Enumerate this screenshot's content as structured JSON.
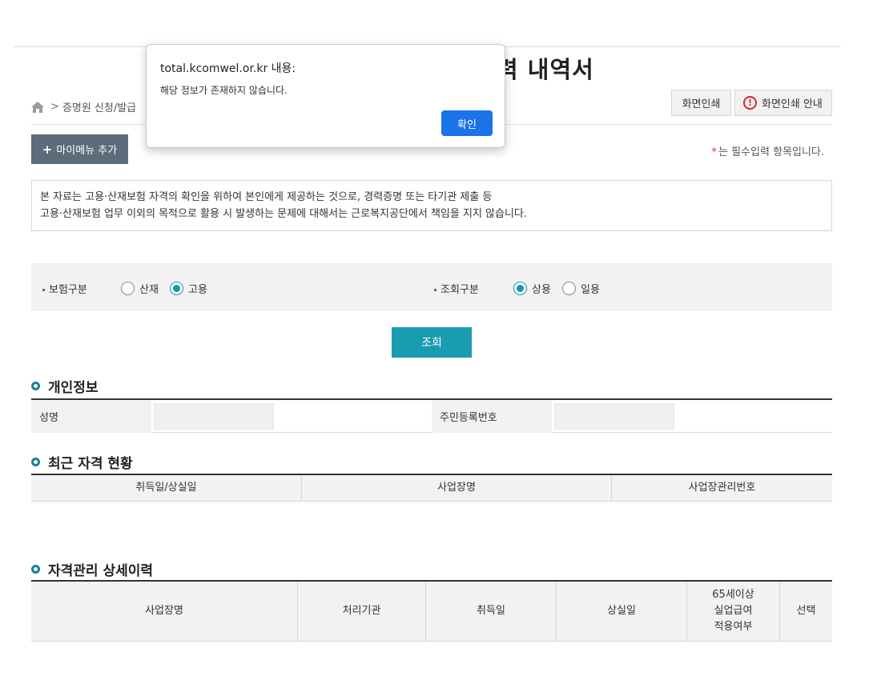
{
  "header": {
    "title": "력 내역서",
    "breadcrumb": {
      "home_icon": "home-icon",
      "separator": ">",
      "item": "증명원 신청/발급"
    },
    "print_button": "화면인쇄",
    "print_guide_button": "화면인쇄 안내",
    "print_guide_icon": "exclamation-circle-icon"
  },
  "toolbar": {
    "mymenu_plus": "+",
    "mymenu_label": "마이메뉴 추가",
    "required_star": "*",
    "required_note": "는 필수입력 항목입니다."
  },
  "notice": {
    "line1": "본 자료는 고용·산재보험 자격의 확인을 위하여 본인에게 제공하는 것으로, 경력증명 또는 타기관 제출 등",
    "line2": "고용·산재보험 업무 이외의 목적으로 활용 시 발생하는 문제에 대해서는 근로복지공단에서 책임을 지지 않습니다."
  },
  "search": {
    "insurance_label": "보험구분",
    "insurance_options": [
      {
        "label": "산재",
        "selected": false
      },
      {
        "label": "고용",
        "selected": true
      }
    ],
    "query_type_label": "조회구분",
    "query_type_options": [
      {
        "label": "상용",
        "selected": true
      },
      {
        "label": "일용",
        "selected": false
      }
    ],
    "submit_label": "조회"
  },
  "personal_info": {
    "title": "개인정보",
    "name_label": "성명",
    "rrn_label": "주민등록번호"
  },
  "recent_status": {
    "title": "최근 자격 현황",
    "columns": [
      "취득일/상실일",
      "사업장명",
      "사업장관리번호"
    ]
  },
  "detail_history": {
    "title": "자격관리 상세이력",
    "columns": [
      "사업장명",
      "처리기관",
      "취득일",
      "상실일",
      "65세이상\n실업급여\n적용여부",
      "선택"
    ]
  },
  "dialog": {
    "origin": "total.kcomwel.or.kr 내용:",
    "message": "해당 정보가 존재하지 않습니다.",
    "ok_label": "확인"
  },
  "colors": {
    "accent_teal": "#1a9cb0",
    "radio_selected": "#1395b8",
    "mymenu_bg": "#5d6b7a",
    "dialog_ok": "#1a73e8",
    "required_star": "#e0343a"
  }
}
